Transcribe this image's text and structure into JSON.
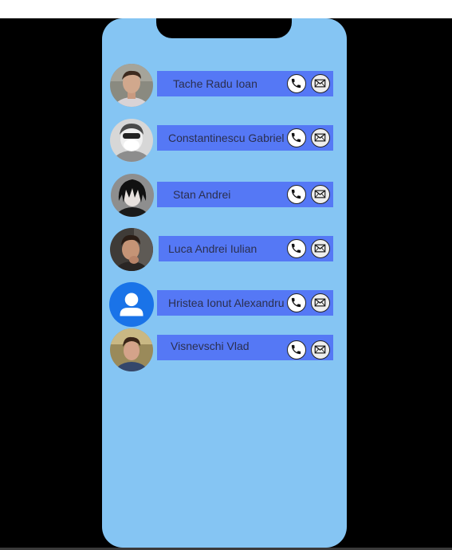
{
  "contacts": [
    {
      "name": "Tache Radu Ioan",
      "avatar": "photo-man-shirt-icon",
      "call_icon": "phone-icon",
      "mail_icon": "envelope-icon"
    },
    {
      "name": "Constantinescu Gabriel",
      "avatar": "photo-man-masked-icon",
      "call_icon": "phone-icon",
      "mail_icon": "envelope-icon"
    },
    {
      "name": "Stan Andrei",
      "avatar": "anime-character-icon",
      "call_icon": "phone-icon",
      "mail_icon": "envelope-icon"
    },
    {
      "name": "Luca Andrei Iulian",
      "avatar": "photo-man-dark-icon",
      "call_icon": "phone-icon",
      "mail_icon": "envelope-icon"
    },
    {
      "name": "Hristea Ionut Alexandru",
      "avatar": "default-person-icon",
      "call_icon": "phone-icon",
      "mail_icon": "envelope-icon"
    },
    {
      "name": "Visnevschi Vlad",
      "avatar": "photo-man-outdoor-icon",
      "call_icon": "phone-icon",
      "mail_icon": "envelope-icon"
    }
  ],
  "colors": {
    "background": "#000000",
    "phone_body": "#85c5f3",
    "contact_bar": "#5578f5",
    "name_text": "#2b2f4f",
    "default_avatar": "#1a73e8"
  }
}
